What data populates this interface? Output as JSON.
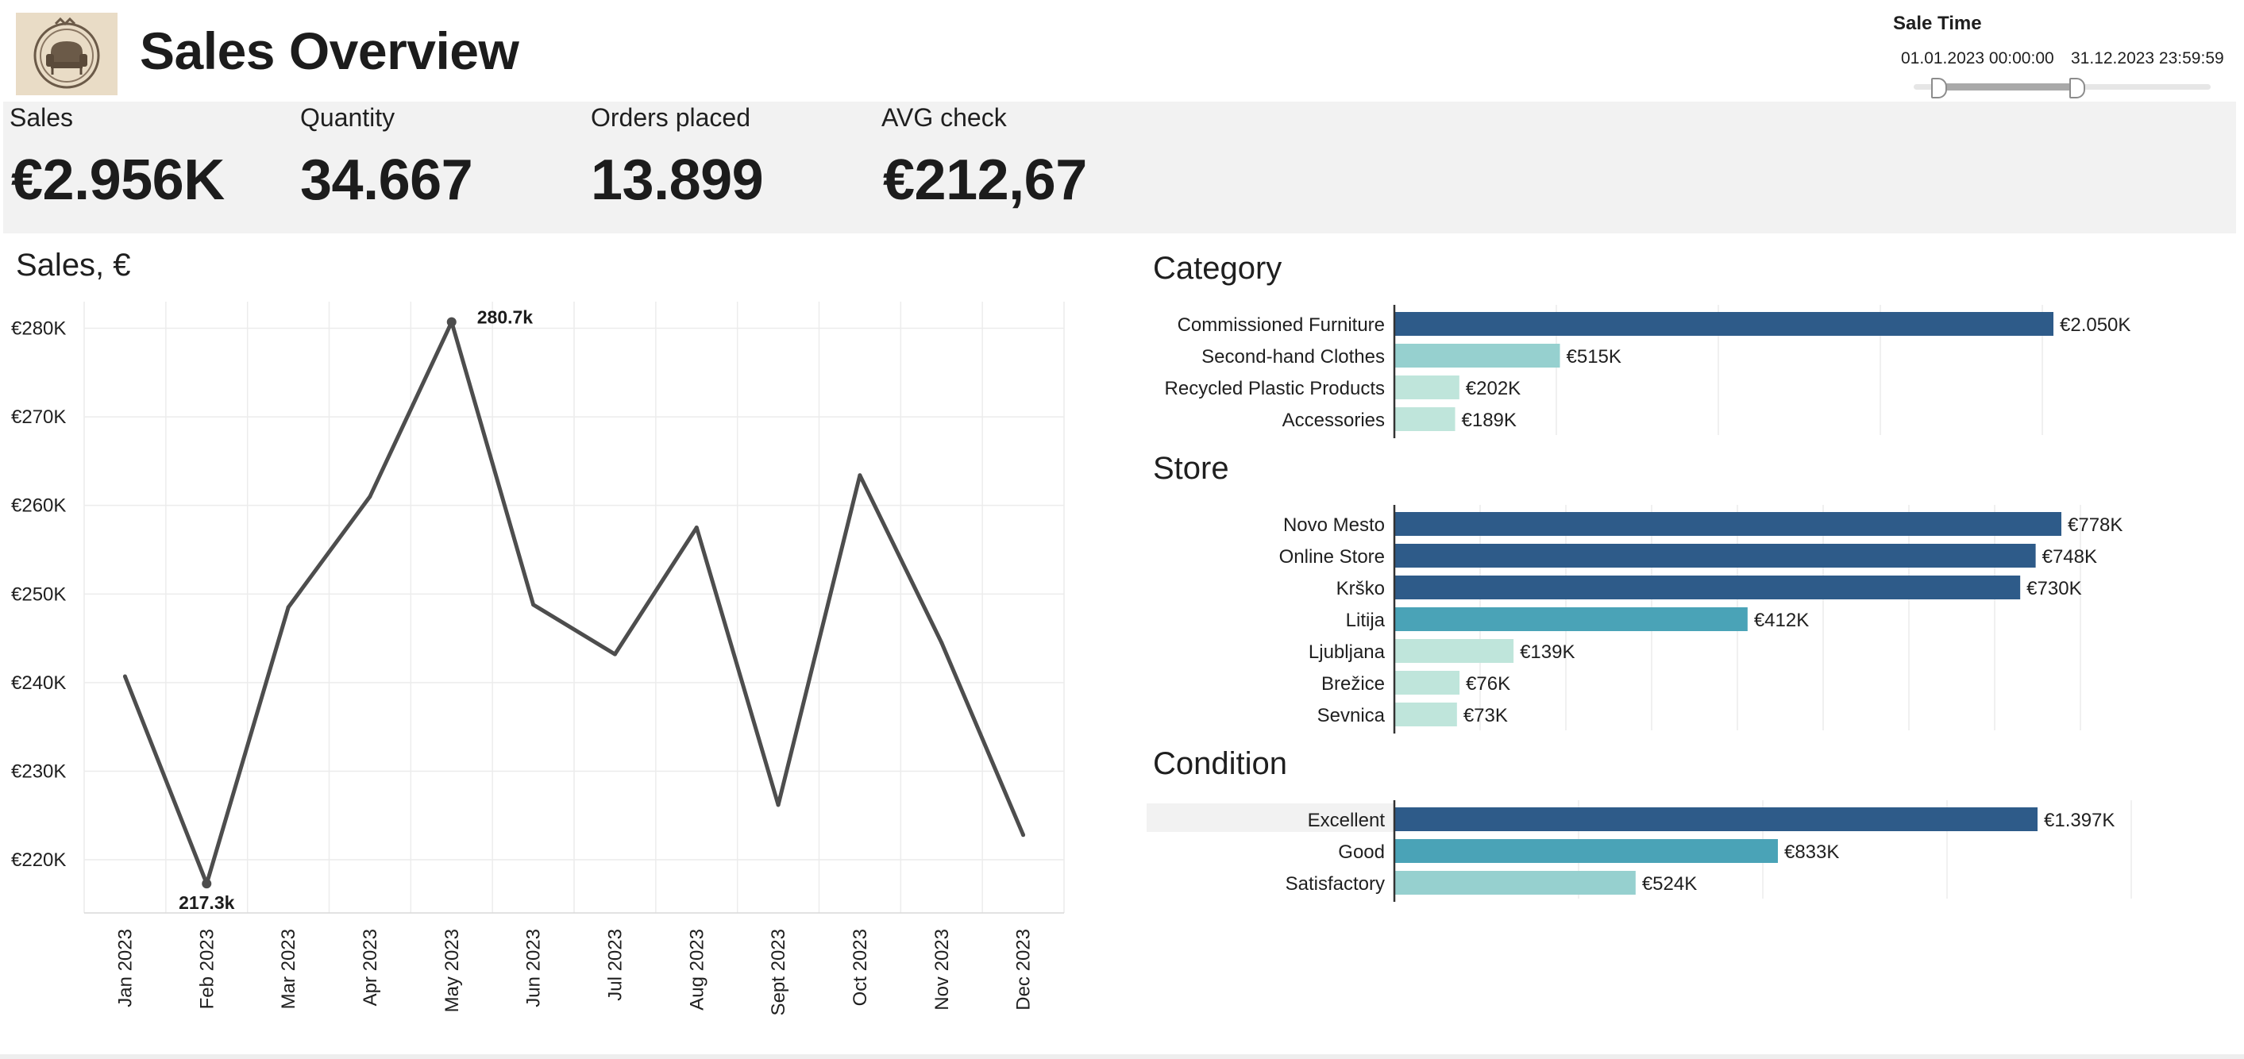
{
  "header": {
    "title": "Sales Overview",
    "logo_icon": "armchair-logo-icon"
  },
  "filter": {
    "title": "Sale Time",
    "start": "01.01.2023 00:00:00",
    "end": "31.12.2023 23:59:59"
  },
  "kpis": [
    {
      "label": "Sales",
      "value": "€2.956K"
    },
    {
      "label": "Quantity",
      "value": "34.667"
    },
    {
      "label": "Orders placed",
      "value": "13.899"
    },
    {
      "label": "AVG check",
      "value": "€212,67"
    }
  ],
  "colors": {
    "dark_blue": "#2e5b89",
    "mid_teal": "#4aa3b7",
    "light_teal": "#96d0cf",
    "pale_teal": "#bfe5db",
    "line": "#4d4d4d",
    "kpi_band": "#f2f2f2"
  },
  "chart_data": [
    {
      "type": "line",
      "title": "Sales, €",
      "categories": [
        "Jan 2023",
        "Feb 2023",
        "Mar 2023",
        "Apr 2023",
        "May 2023",
        "Jun 2023",
        "Jul 2023",
        "Aug 2023",
        "Sept 2023",
        "Oct 2023",
        "Nov 2023",
        "Dec 2023"
      ],
      "values": [
        240.7,
        217.3,
        248.5,
        261.0,
        280.7,
        248.8,
        243.2,
        257.5,
        226.2,
        263.4,
        244.5,
        222.8
      ],
      "y_ticks": [
        "€220K",
        "€230K",
        "€240K",
        "€250K",
        "€260K",
        "€270K",
        "€280K"
      ],
      "ylim": [
        214,
        283
      ],
      "annotations": [
        {
          "category": "May 2023",
          "label": "280.7k"
        },
        {
          "category": "Feb 2023",
          "label": "217.3k"
        }
      ],
      "grid": true
    },
    {
      "type": "bar",
      "title": "Category",
      "categories": [
        "Commissioned Furniture",
        "Second-hand Clothes",
        "Recycled Plastic Products",
        "Accessories"
      ],
      "values": [
        2050,
        515,
        202,
        189
      ],
      "labels": [
        "€2.050K",
        "€515K",
        "€202K",
        "€189K"
      ],
      "units": "K€"
    },
    {
      "type": "bar",
      "title": "Store",
      "categories": [
        "Novo Mesto",
        "Online Store",
        "Krško",
        "Litija",
        "Ljubljana",
        "Brežice",
        "Sevnica"
      ],
      "values": [
        778,
        748,
        730,
        412,
        139,
        76,
        73
      ],
      "labels": [
        "€778K",
        "€748K",
        "€730K",
        "€412K",
        "€139K",
        "€76K",
        "€73K"
      ],
      "units": "K€"
    },
    {
      "type": "bar",
      "title": "Condition",
      "categories": [
        "Excellent",
        "Good",
        "Satisfactory"
      ],
      "values": [
        1397,
        833,
        524
      ],
      "labels": [
        "€1.397K",
        "€833K",
        "€524K"
      ],
      "units": "K€"
    }
  ]
}
